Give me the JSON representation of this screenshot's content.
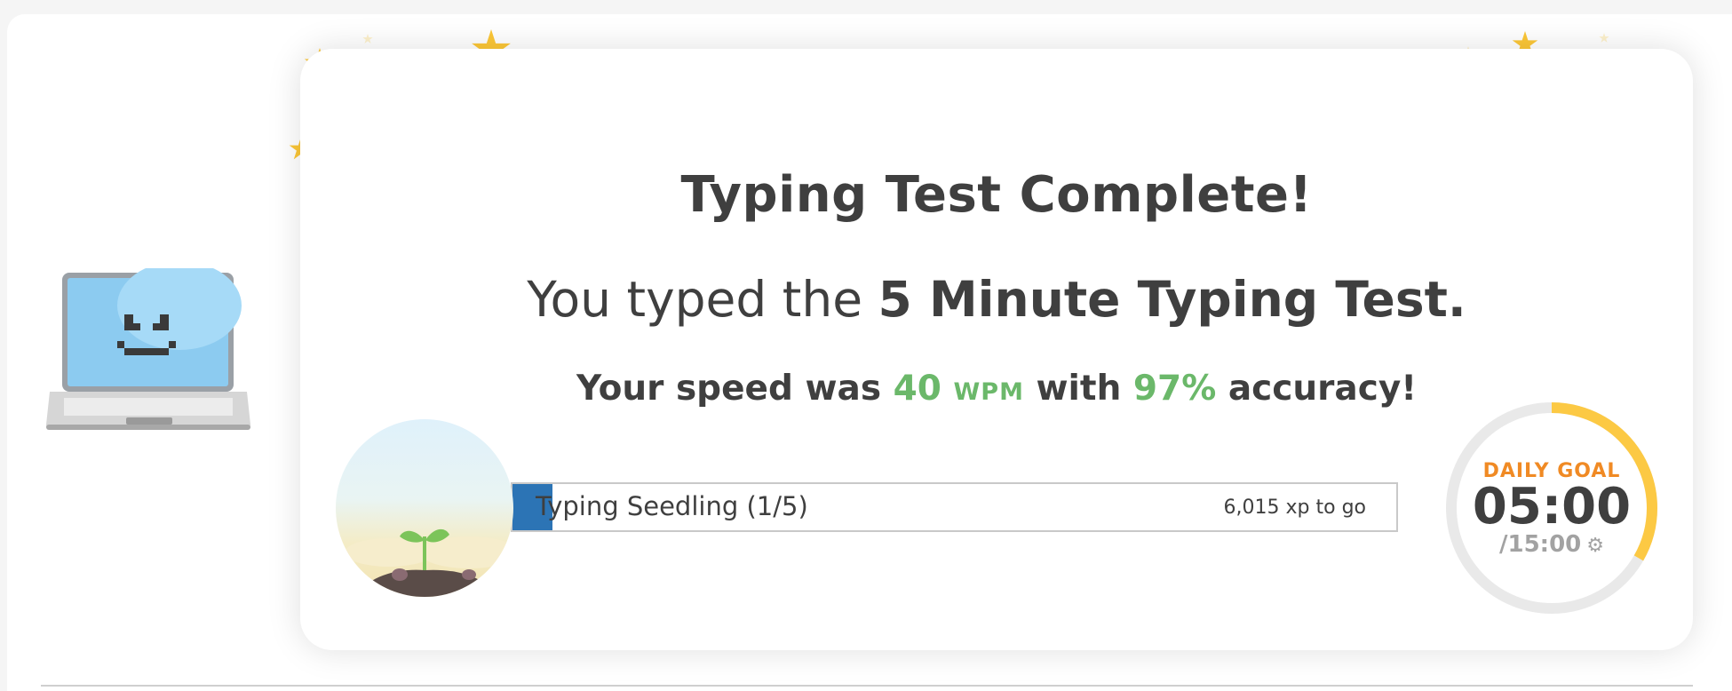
{
  "result": {
    "title": "Typing Test Complete!",
    "subtitle_prefix": "You typed the ",
    "test_name": "5 Minute Typing Test.",
    "speed_prefix": "Your speed was ",
    "wpm": "40",
    "wpm_unit": "WPM",
    "with_word": " with ",
    "accuracy": "97%",
    "accuracy_suffix": " accuracy!"
  },
  "rank": {
    "label": "Typing Seedling (1/5)",
    "xp_to_go": "6,015 xp to go",
    "progress_fraction": 0.045,
    "icon": "seedling-icon"
  },
  "daily_goal": {
    "title": "DAILY GOAL",
    "time": "05:00",
    "total": "/15:00",
    "progress_fraction": 0.333,
    "gear_icon": "gear-icon"
  },
  "colors": {
    "accent_green": "#6bb86a",
    "goal_orange": "#f08a24",
    "goal_ring": "#fcc944",
    "progress_blue": "#2c74b5",
    "star_gold": "#fcc737"
  },
  "mascot": {
    "icon": "laptop-mascot-icon"
  }
}
